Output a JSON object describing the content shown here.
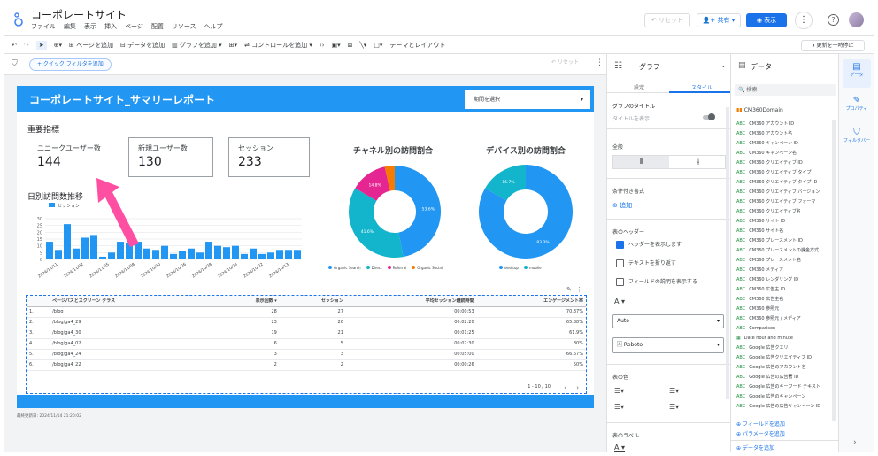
{
  "app": {
    "title": "コーポレートサイト",
    "menus": [
      "ファイル",
      "編集",
      "表示",
      "挿入",
      "ページ",
      "配置",
      "リソース",
      "ヘルプ"
    ],
    "reset_label": "リセット",
    "share_label": "共有",
    "view_label": "表示",
    "help_glyph": "?",
    "accent": "#1a73e8"
  },
  "toolbar": {
    "add_page": "ページを追加",
    "add_data": "データを追加",
    "add_chart": "グラフを追加",
    "add_control": "コントロールを追加",
    "theme": "テーマとレイアウト",
    "pause": "更新を一時停止"
  },
  "filterbar": {
    "quick_filter": "+ クイック フィルタを追加",
    "reset": "リセット"
  },
  "report": {
    "title": "コーポレートサイト_サマリーレポート",
    "period_select": "期間を選択",
    "kpi_heading": "重要指標",
    "kpis": [
      {
        "label": "ユニークユーザー数",
        "value": "144"
      },
      {
        "label": "新規ユーザー数",
        "value": "130"
      },
      {
        "label": "セッション",
        "value": "233"
      }
    ],
    "daily_heading": "日別訪問数推移",
    "footer": "最終更新日: 2024/11/14 21:20:02"
  },
  "chart_data": [
    {
      "type": "bar",
      "title": "日別訪問数推移",
      "series": [
        {
          "name": "セッション",
          "values": [
            13,
            7,
            26,
            8,
            16,
            18,
            2,
            5,
            13,
            12,
            13,
            8,
            7,
            10,
            4,
            6,
            8,
            5,
            13,
            10,
            9,
            10,
            4,
            8,
            4,
            5,
            7,
            7,
            7
          ]
        }
      ],
      "ylim": [
        0,
        30
      ],
      "yticks": [
        0,
        5,
        10,
        15,
        20,
        25,
        30
      ],
      "xticklabels": [
        "2024/11/11",
        "2024/11/02",
        "2024/11/05",
        "2024/11/08",
        "2024/10/30",
        "2024/10/26",
        "2024/10/28",
        "2024/10/24",
        "2024/10/22",
        "2024/10/13"
      ],
      "color": "#2196f3"
    },
    {
      "type": "pie",
      "title": "チャネル別の訪問割合",
      "categories": [
        "Organic Search",
        "Direct",
        "Referral",
        "Organic Social"
      ],
      "values": [
        53.6,
        41.6,
        14.8,
        4.0
      ],
      "labels": [
        "53.6%",
        "41.6%",
        "14.8%",
        ""
      ],
      "colors": [
        "#2196f3",
        "#12b5cb",
        "#e52592",
        "#f57c00"
      ],
      "extra_color": "#81c995"
    },
    {
      "type": "pie",
      "title": "デバイス別の訪問割合",
      "categories": [
        "desktop",
        "mobile"
      ],
      "values": [
        83.3,
        16.7
      ],
      "labels": [
        "83.3%",
        "16.7%"
      ],
      "colors": [
        "#2196f3",
        "#12b5cb"
      ]
    }
  ],
  "table": {
    "headers": [
      "ページパスとスクリーン クラス",
      "表示回数 ▾",
      "セッション",
      "平均セッション継続時間",
      "エンゲージメント率"
    ],
    "rows": [
      [
        "1.",
        "/blog",
        "28",
        "27",
        "00:00:53",
        "70.37%"
      ],
      [
        "2.",
        "/blog/ga4_29",
        "23",
        "26",
        "00:02:20",
        "65.38%"
      ],
      [
        "3.",
        "/blog/ga4_30",
        "19",
        "21",
        "00:01:25",
        "61.9%"
      ],
      [
        "4.",
        "/blog/ga4_02",
        "6",
        "5",
        "00:02:30",
        "80%"
      ],
      [
        "5.",
        "/blog/ga4_24",
        "3",
        "3",
        "00:05:00",
        "66.67%"
      ],
      [
        "6.",
        "/blog/ga4_22",
        "2",
        "2",
        "00:00:26",
        "50%"
      ]
    ],
    "pagination": "1 - 10 / 10"
  },
  "props": {
    "title": "グラフ",
    "tabs": [
      "設定",
      "スタイル"
    ],
    "chart_title": "グラフのタイトル",
    "show_title": "タイトルを表示",
    "fill": "全般",
    "conditional": "条件付き書式",
    "add": "追加",
    "table_header": "表のヘッダー",
    "show_header": "ヘッダーを表示します",
    "wrap_text": "テキストを折り返す",
    "show_sort": "フィールドの説明を表示する",
    "font_color": "A",
    "size": "Auto",
    "font": "Roboto",
    "table_color": "表の色",
    "table_label": "表のラベル"
  },
  "data": {
    "title": "データ",
    "search": "検索",
    "source": "CM360Domain",
    "fields": [
      "CM360 アカウント ID",
      "CM360 アカウント名",
      "CM360 キャンペーン ID",
      "CM360 キャンペーン名",
      "CM360 クリエイティブ ID",
      "CM360 クリエイティブ タイプ",
      "CM360 クリエイティブ タイプ ID",
      "CM360 クリエイティブ バージョン",
      "CM360 クリエイティブ フォーマ",
      "CM360 クリエイティブ名",
      "CM360 サイト ID",
      "CM360 サイト名",
      "CM360 プレースメント ID",
      "CM360 プレースメントの課金方式",
      "CM360 プレースメント名",
      "CM360 メディア",
      "CM360 レンダリング ID",
      "CM360 広告主 ID",
      "CM360 広告主名",
      "CM360 参照元",
      "CM360 参照元 / メディア",
      "Comparison",
      "Date hour and minute",
      "Google 広告クエリ",
      "Google 広告クリエイティブ ID",
      "Google 広告のアカウント名",
      "Google 広告の広告著 ID",
      "Google 広告のキーワード テキスト",
      "Google 広告のキャンペーン",
      "Google 広告の広告キャンペーン ID"
    ],
    "add_field": "フィールドを追加",
    "add_param": "パラメータを追加",
    "add_data": "データを追加"
  },
  "rail": {
    "data": "データ",
    "props": "プロパティ",
    "filter": "フィルタバー"
  }
}
